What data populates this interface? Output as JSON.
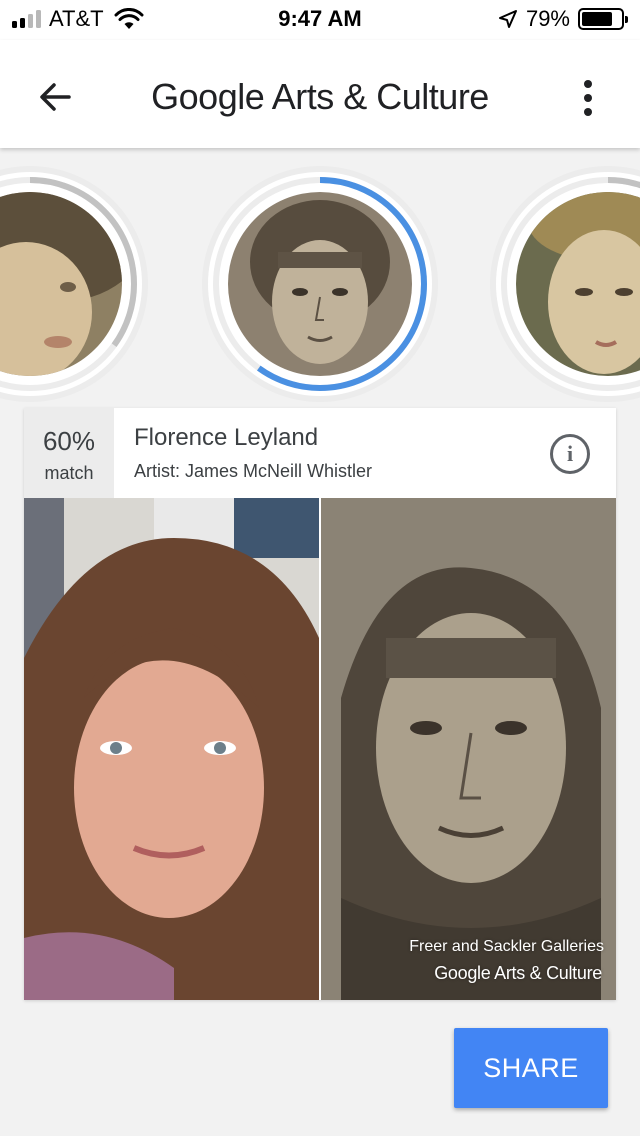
{
  "status_bar": {
    "carrier": "AT&T",
    "time": "9:47 AM",
    "battery": "79%",
    "battery_level": 0.79,
    "signal_bars": 2,
    "icons": [
      "signal-icon",
      "wifi-icon",
      "location-arrow-icon",
      "battery-icon"
    ]
  },
  "app_bar": {
    "title": "Google Arts & Culture",
    "icons": [
      "back-arrow-icon",
      "more-vert-icon"
    ]
  },
  "carousel": {
    "items": [
      {
        "name": "portrait-left",
        "progress": 0.35
      },
      {
        "name": "portrait-selected",
        "progress": 0.6,
        "selected": true
      },
      {
        "name": "portrait-right",
        "progress": 0.25
      }
    ],
    "colors": {
      "ring_active": "#4a90e2",
      "ring_inactive": "#c2c2c2"
    }
  },
  "match": {
    "percent": "60%",
    "label": "match",
    "title": "Florence Leyland",
    "artist": "Artist: James McNeill Whistler",
    "info_icon": "info-icon"
  },
  "comparison": {
    "credit": "Freer and Sackler Galleries",
    "logo": "Google Arts & Culture"
  },
  "share": {
    "label": "SHARE"
  },
  "colors": {
    "accent": "#4285f4",
    "background": "#f2f2f2"
  }
}
